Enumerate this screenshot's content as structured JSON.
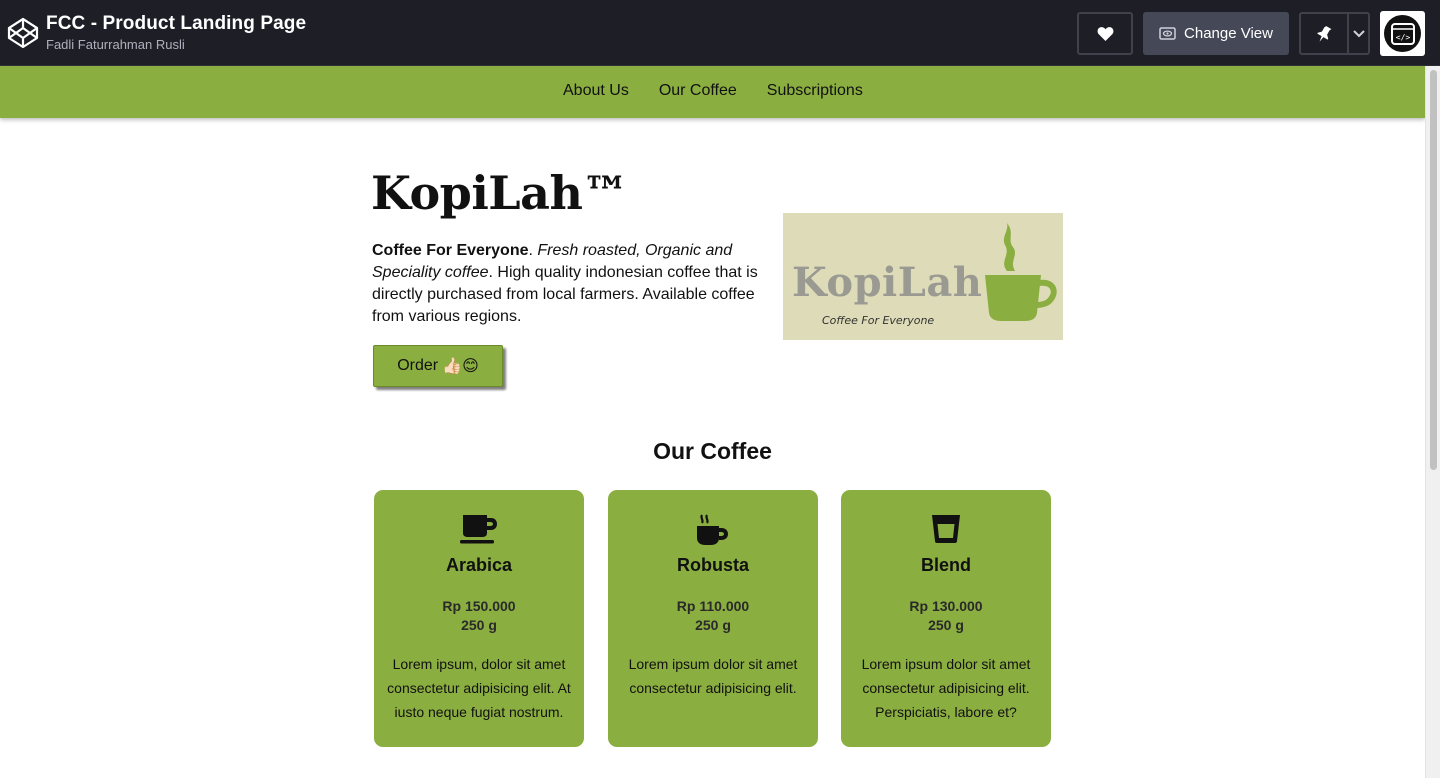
{
  "codepen": {
    "title": "FCC - Product Landing Page",
    "author": "Fadli Faturrahman Rusli",
    "change_view_label": "Change View",
    "icons": [
      "codepen-logo-icon",
      "heart-icon",
      "eye-icon",
      "pin-icon",
      "chevron-down-icon",
      "code-icon"
    ]
  },
  "nav": {
    "items": [
      {
        "label": "About Us"
      },
      {
        "label": "Our Coffee"
      },
      {
        "label": "Subscriptions"
      }
    ]
  },
  "hero": {
    "brand": "KopiLah™",
    "lead_bold": "Coffee For Everyone",
    "lead_sep": ". ",
    "lead_italic": "Fresh roasted, Organic and Speciality coffee",
    "lead_rest": ". High quality indonesian coffee that is directly purchased from local farmers. Available coffee from various regions.",
    "order_label": "Order",
    "order_emoji": "👍🏻😊",
    "image_word": "KopiLah",
    "image_tagline": "Coffee For Everyone"
  },
  "coffee": {
    "section_title": "Our Coffee",
    "products": [
      {
        "name": "Arabica",
        "price": "Rp 150.000",
        "weight": "250 g",
        "description": "Lorem ipsum, dolor sit amet consectetur adipisicing elit. At iusto neque fugiat nostrum.",
        "icon": "mug-icon"
      },
      {
        "name": "Robusta",
        "price": "Rp 110.000",
        "weight": "250 g",
        "description": "Lorem ipsum dolor sit amet consectetur adipisicing elit.",
        "icon": "hot-mug-icon"
      },
      {
        "name": "Blend",
        "price": "Rp 130.000",
        "weight": "250 g",
        "description": "Lorem ipsum dolor sit amet consectetur adipisicing elit. Perspiciatis, labore et?",
        "icon": "glass-icon"
      }
    ]
  },
  "colors": {
    "topbar": "#1e1f26",
    "accent_green": "#8bae40",
    "button_gray": "#444857"
  }
}
